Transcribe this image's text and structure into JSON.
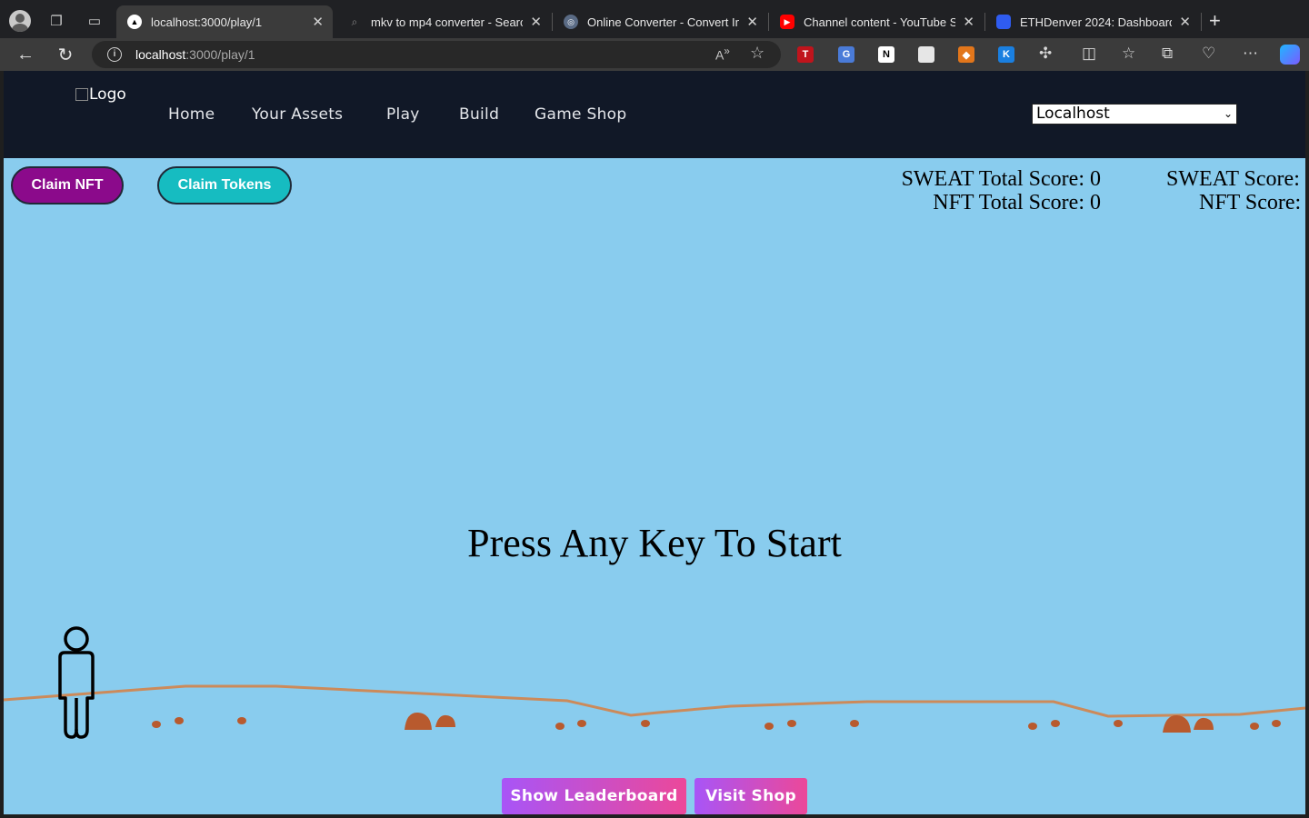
{
  "browser": {
    "tabs": [
      {
        "title": "localhost:3000/play/1",
        "active": true,
        "favicon": "triangle-icon"
      },
      {
        "title": "mkv to mp4 converter - Search",
        "active": false,
        "favicon": "search-icon"
      },
      {
        "title": "Online Converter - Convert Ima",
        "active": false,
        "favicon": "converter-icon"
      },
      {
        "title": "Channel content - YouTube Stu",
        "active": false,
        "favicon": "youtube-icon"
      },
      {
        "title": "ETHDenver 2024: Dashboard |",
        "active": false,
        "favicon": "ethdenver-icon"
      }
    ],
    "url_host": "localhost",
    "url_path": ":3000/play/1"
  },
  "site": {
    "logo_alt": "Logo",
    "nav": [
      "Home",
      "Your Assets",
      "Play",
      "Build",
      "Game Shop"
    ],
    "network_selected": "Localhost"
  },
  "actions": {
    "claim_nft": "Claim NFT",
    "claim_tokens": "Claim Tokens"
  },
  "scores": {
    "sweat_total": "SWEAT Total Score: 0",
    "nft_total": "NFT Total Score: 0",
    "sweat": "SWEAT Score:",
    "nft": "NFT Score:"
  },
  "game": {
    "prompt": "Press Any Key To Start"
  },
  "bottom": {
    "leaderboard": "Show Leaderboard",
    "shop": "Visit Shop"
  },
  "colors": {
    "sky": "#89ccee",
    "navbar": "#111827",
    "claim_nft_bg": "#8b0a8b",
    "claim_tokens_bg": "#16bcc1",
    "ground_line": "#cc8a5a",
    "rock": "#b85a2e"
  }
}
